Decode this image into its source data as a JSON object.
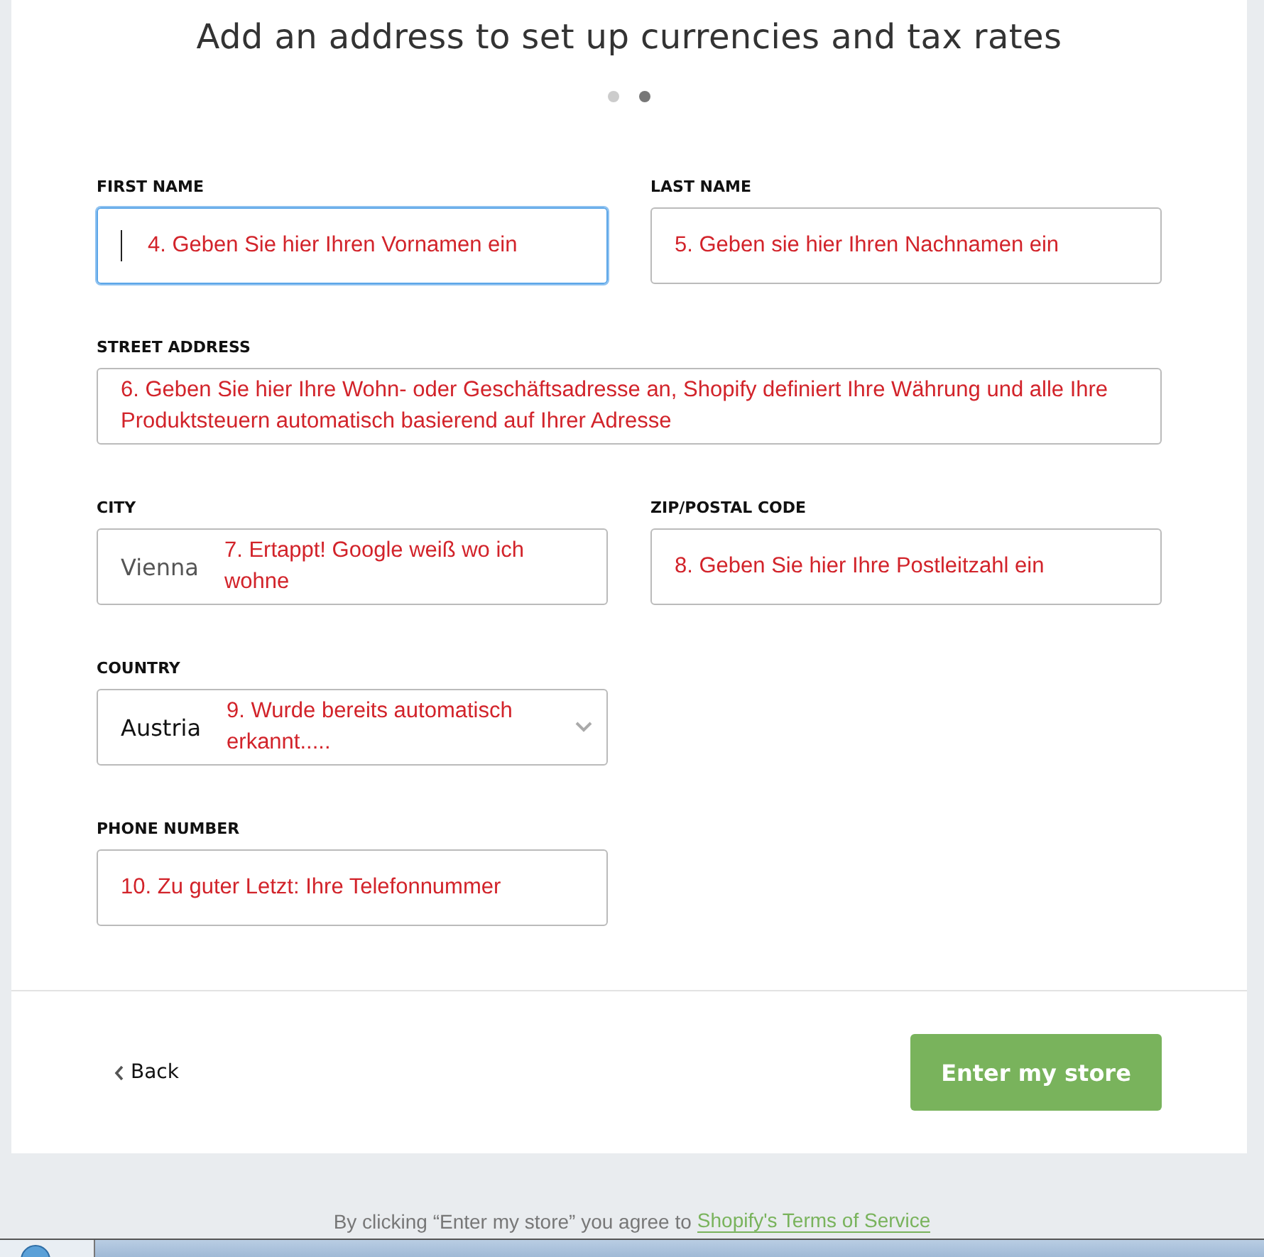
{
  "title": "Add an address to set up currencies and tax rates",
  "steps": [
    {
      "selected": false
    },
    {
      "selected": true
    }
  ],
  "rows": [
    [
      {
        "label": "FIRST NAME",
        "kind": "text",
        "annotation": "4. Geben Sie hier Ihren Vornamen ein",
        "focused": true
      },
      {
        "label": "LAST NAME",
        "kind": "text",
        "annotation": "5. Geben sie hier Ihren Nachnamen ein",
        "focused": false
      }
    ],
    [
      {
        "label": "STREET ADDRESS",
        "kind": "wide",
        "annotation": "6. Geben Sie hier Ihre Wohn- oder Geschäftsadresse an, Shopify definiert Ihre Währung und alle Ihre Produktsteuern automatisch basierend auf Ihrer Adresse",
        "focused": false
      }
    ],
    [
      {
        "label": "CITY",
        "kind": "text",
        "value": "Vienna",
        "annotation": "7. Ertappt! Google weiß wo ich wohne",
        "focused": false
      },
      {
        "label": "ZIP/POSTAL CODE",
        "kind": "text",
        "annotation": "8. Geben Sie hier Ihre Postleitzahl ein",
        "focused": false
      }
    ],
    [
      {
        "label": "COUNTRY",
        "kind": "select",
        "value": "Austria",
        "annotation": "9. Wurde bereits automatisch erkannt.....",
        "focused": false
      }
    ],
    [
      {
        "label": "PHONE NUMBER",
        "kind": "text",
        "annotation": "10. Zu guter Letzt: Ihre Telefonnummer",
        "focused": false
      }
    ]
  ],
  "back": "Back",
  "submit": "Enter my store",
  "terms": {
    "text": "By clicking “Enter my store” you agree to",
    "link": "Shopify's Terms of Service"
  }
}
